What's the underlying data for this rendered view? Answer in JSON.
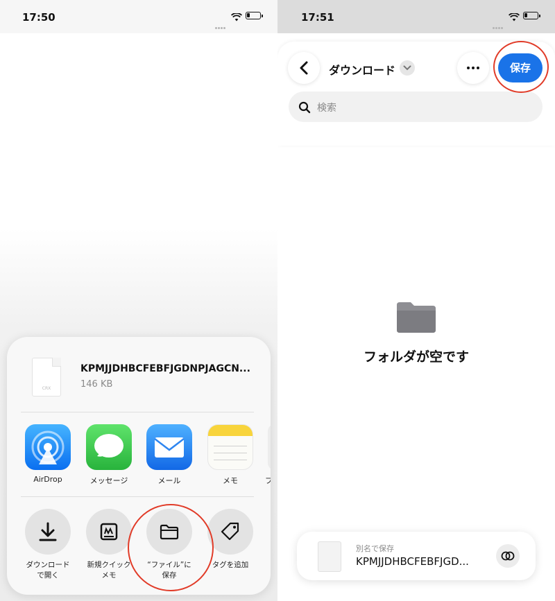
{
  "left": {
    "status": {
      "time": "17:50"
    },
    "share_sheet": {
      "file": {
        "name": "KPMJJDHBCFEBFJGDNPJAGCN...",
        "size": "146 KB",
        "thumb_ext": "CRX"
      },
      "apps": [
        {
          "label": "AirDrop",
          "icon": "airdrop-icon"
        },
        {
          "label": "メッセージ",
          "icon": "messages-icon"
        },
        {
          "label": "メール",
          "icon": "mail-icon"
        },
        {
          "label": "メモ",
          "icon": "notes-icon"
        },
        {
          "label": "フ",
          "icon": "app-icon"
        }
      ],
      "actions": [
        {
          "line1": "ダウンロード",
          "line2": "で開く",
          "icon": "download-icon"
        },
        {
          "line1": "新規クイック",
          "line2": "メモ",
          "icon": "quick-note-icon"
        },
        {
          "line1": "“ファイル”に",
          "line2": "保存",
          "icon": "folder-icon"
        },
        {
          "line1": "タグを追加",
          "line2": "",
          "icon": "tag-icon"
        }
      ]
    }
  },
  "right": {
    "status": {
      "time": "17:51"
    },
    "nav": {
      "folder_title": "ダウンロード",
      "save_label": "保存",
      "search_placeholder": "検索"
    },
    "empty_message": "フォルダが空です",
    "save_as": {
      "label": "別名で保存",
      "filename": "KPMJJDHBCFEBFJGD..."
    }
  },
  "colors": {
    "accent": "#1a73e8",
    "highlight_circle": "#e13b28"
  }
}
